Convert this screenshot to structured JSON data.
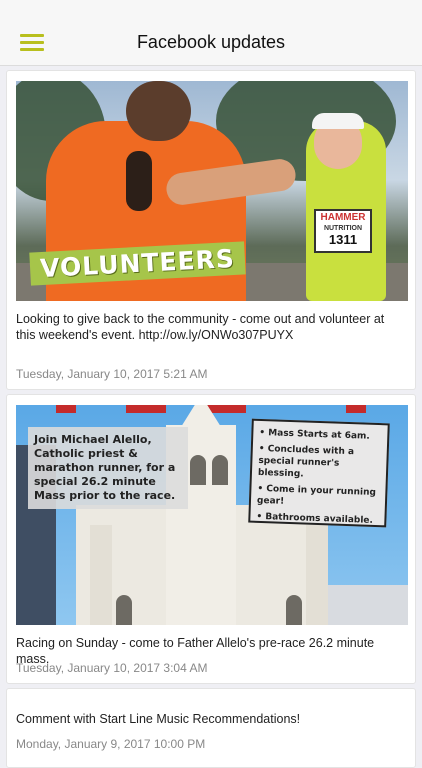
{
  "header": {
    "title": "Facebook updates"
  },
  "posts": [
    {
      "image": {
        "banner": "VOLUNTEERS",
        "bib_brand": "HAMMER",
        "bib_sub": "NUTRITION",
        "bib_number": "1311"
      },
      "text": "Looking to give back to the community - come out and volunteer at this weekend's event. http://ow.ly/ONWo307PUYX",
      "date": "Tuesday, January 10, 2017 5:21 AM"
    },
    {
      "image": {
        "left_sign": "Join Michael Alello, Catholic priest & marathon runner, for a special 26.2 minute Mass prior to the race.",
        "right_sign": [
          "• Mass Starts at 6am.",
          "• Concludes with a special runner's blessing.",
          "• Come in your running gear!",
          "• Bathrooms available."
        ]
      },
      "text": "Racing on Sunday - come to Father Allelo's pre-race 26.2 minute mass.",
      "date": "Tuesday, January 10, 2017 3:04 AM"
    },
    {
      "text": "Comment with Start Line Music Recommendations!",
      "date": "Monday, January 9, 2017 10:00 PM"
    }
  ],
  "colors": {
    "accent": "#b8bf1e"
  }
}
